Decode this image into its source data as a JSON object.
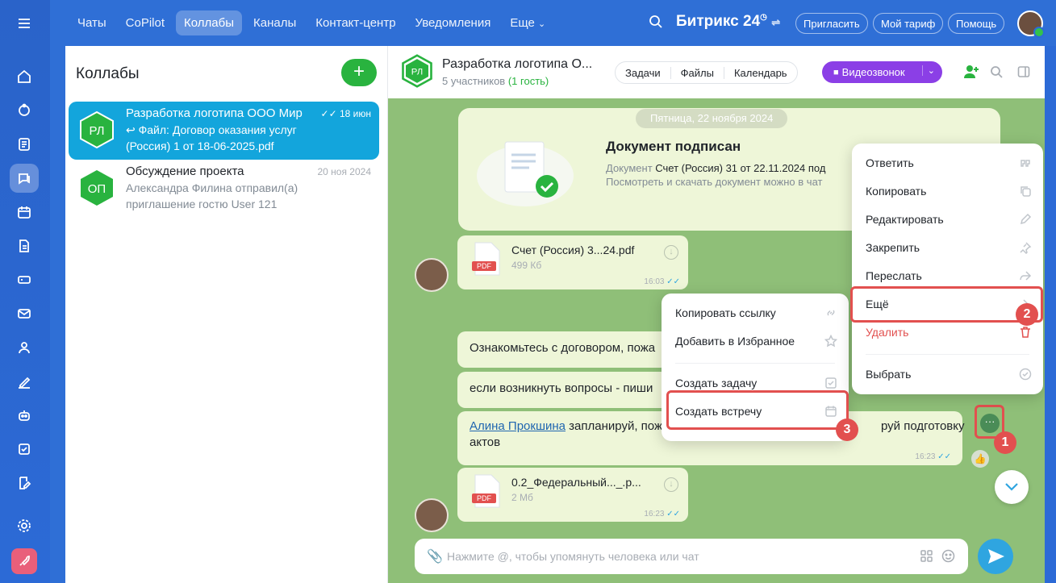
{
  "topbar": {
    "nav": [
      "Чаты",
      "CoPilot",
      "Коллабы",
      "Каналы",
      "Контакт-центр",
      "Уведомления",
      "Еще"
    ],
    "brand": "Битрикс 24",
    "invite": "Пригласить",
    "tariff": "Мой тариф",
    "help": "Помощь"
  },
  "list": {
    "title": "Коллабы",
    "items": [
      {
        "initials": "РЛ",
        "name": "Разработка логотипа ООО Мир",
        "date": "18 июн",
        "line1": "Файл: Договор оказания услуг",
        "line2": "(Россия) 1 от 18-06-2025.pdf"
      },
      {
        "initials": "ОП",
        "name": "Обсуждение проекта",
        "date": "20 ноя 2024",
        "line1": "Александра Филина отправил(а)",
        "line2": "приглашение гостю User 121"
      }
    ]
  },
  "chat": {
    "initials": "РЛ",
    "title": "Разработка логотипа О...",
    "members": "5 участников",
    "guest": "(1 гость)",
    "tabs": [
      "Задачи",
      "Файлы",
      "Календарь"
    ],
    "video": "Видеозвонок",
    "date_chip": "Пятница, 22 ноября 2024",
    "doc_title": "Документ подписан",
    "doc_line1_a": "Документ",
    "doc_line1_b": "Счет (Россия) 31 от 22.11.2024 под",
    "doc_line2": "Посмотреть и скачать документ можно в чат",
    "file1": {
      "name": "Счет (Россия) 3...24.pdf",
      "size": "499 Кб",
      "time": "16:03"
    },
    "msg1": "Ознакомьтесь с договором, пожа",
    "msg2": "если возникнуть вопросы - пиши",
    "msg3_mention": "Алина Прокшина",
    "msg3_a": "запланируй, пож",
    "msg3_b": "руй подготовку",
    "msg3_c": "актов",
    "msg3_time": "16:23",
    "file2": {
      "name": "0.2_Федеральный..._.р...",
      "size": "2 Мб",
      "time": "16:23"
    },
    "pdf_label": "PDF",
    "input_placeholder": "Нажмите @, чтобы упомянуть человека или чат"
  },
  "menu_main": [
    "Ответить",
    "Копировать",
    "Редактировать",
    "Закрепить",
    "Переслать",
    "Ещё",
    "Удалить",
    "Выбрать"
  ],
  "menu_sub": [
    "Копировать ссылку",
    "Добавить в Избранное",
    "Создать задачу",
    "Создать встречу"
  ],
  "callouts": [
    "1",
    "2",
    "3"
  ],
  "colors": {
    "accent": "#29b33f",
    "highlight": "#e2504f",
    "active_chat": "#13a5dc",
    "video": "#8b3fe6"
  }
}
